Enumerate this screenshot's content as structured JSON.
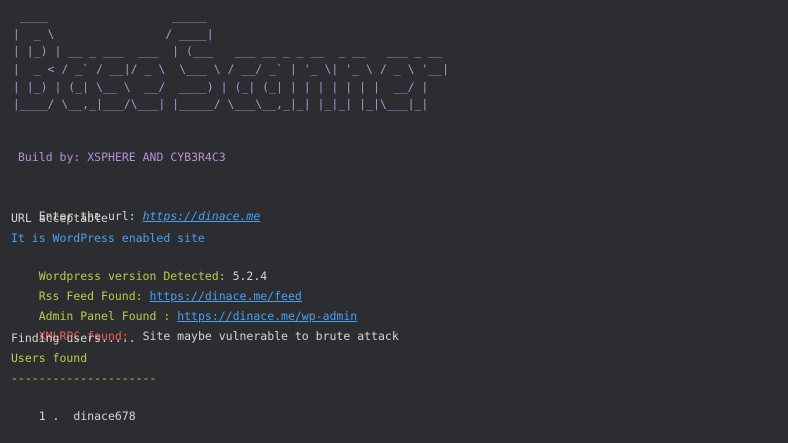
{
  "banner": {
    "lines": [
      "  ____                  _____",
      " |  _ \\                / ____|",
      " | |_) | __ _ ___  ___  | (___   ___ __ _ _ __  _ __   ___ _ __",
      " |  _ < / _` / __|/ _ \\  \\___ \\ / __/ _` | '_ \\| '_ \\ / _ \\ '__|",
      " | |_) | (_| \\__ \\  __/  ____) | (_| (_| | | | | | | |  __/ |",
      " |____/ \\__,_|___/\\___| |_____/ \\___\\__,_|_| |_|_| |_|\\___|_|"
    ]
  },
  "build": "Build by: XSPHERE AND CYB3R4C3",
  "output": {
    "enter_url_label": "Enter the url: ",
    "enter_url_value": "https://dinace.me",
    "url_acceptable": "URL acceptable",
    "wordpress_site": "It is WordPress enabled site",
    "wp_version_label": "Wordpress version Detected: ",
    "wp_version_value": "5.2.4",
    "rss_label": "Rss Feed Found: ",
    "rss_value": "https://dinace.me/feed",
    "admin_label": "Admin Panel Found : ",
    "admin_value": "https://dinace.me/wp-admin",
    "xmlrpc_label": "XMLRPC found:",
    "xmlrpc_value": "  Site maybe vulnerable to brute attack",
    "finding_users": "Finding users.....",
    "users_found": "Users found",
    "separator": "---------------------",
    "user_index": "1 .",
    "user_name": "  dinace678"
  },
  "colors": {
    "background": "#2b2d30",
    "banner": "#b58fd6",
    "text": "#d4d4d4",
    "link": "#4a9ff0",
    "highlight": "#b5cd4a",
    "warning": "#ef5a5a"
  }
}
